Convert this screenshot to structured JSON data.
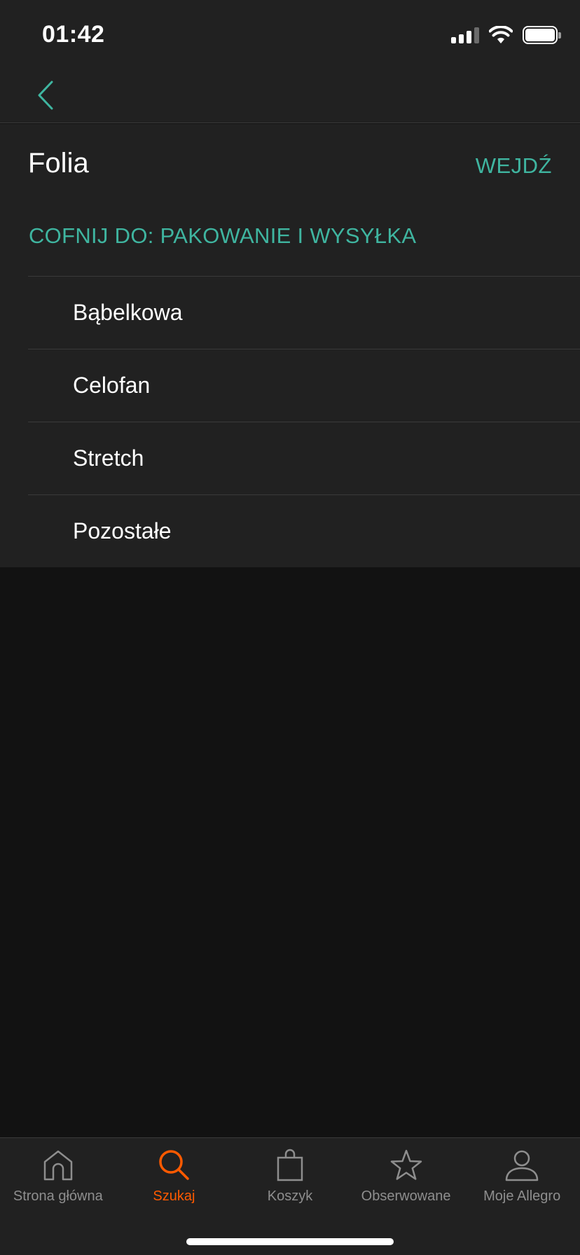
{
  "status_bar": {
    "time": "01:42"
  },
  "colors": {
    "accent": "#3fb5a0",
    "active_tab": "#ff5a00",
    "background": "#121212",
    "surface": "#212121"
  },
  "nav": {
    "back_icon": "chevron-left-icon"
  },
  "header": {
    "title": "Folia",
    "enter_label": "WEJDŹ"
  },
  "back_to": {
    "label": "COFNIJ DO: PAKOWANIE I WYSYŁKA"
  },
  "categories": [
    {
      "label": "Bąbelkowa"
    },
    {
      "label": "Celofan"
    },
    {
      "label": "Stretch"
    },
    {
      "label": "Pozostałe"
    }
  ],
  "tab_bar": {
    "tabs": [
      {
        "label": "Strona główna",
        "icon": "home-icon",
        "active": false
      },
      {
        "label": "Szukaj",
        "icon": "search-icon",
        "active": true
      },
      {
        "label": "Koszyk",
        "icon": "bag-icon",
        "active": false
      },
      {
        "label": "Obserwowane",
        "icon": "star-icon",
        "active": false
      },
      {
        "label": "Moje Allegro",
        "icon": "user-icon",
        "active": false
      }
    ]
  }
}
